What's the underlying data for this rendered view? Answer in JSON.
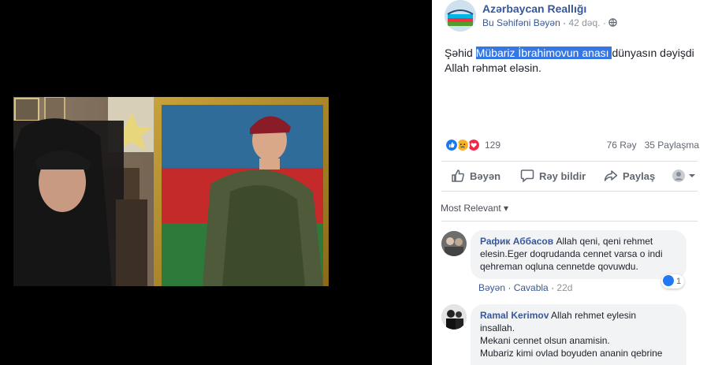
{
  "page": {
    "name": "Azərbaycan Reallığı",
    "like_page": "Bu Səhifəni Bəyən",
    "separator": "·",
    "time": "42 dəq.",
    "privacy_icon": "globe-icon"
  },
  "post": {
    "text_before": "Şəhid ",
    "highlighted": "Mübariz İbrahimovun anası ",
    "text_after": "dünyasın dəyişdi",
    "line2": "Allah rəhmət eləsin."
  },
  "reactions": {
    "count": "129",
    "icons": [
      "like-icon",
      "sad-icon",
      "love-icon"
    ],
    "comments": "76 Rəy",
    "shares": "35 Paylaşma",
    "colors": {
      "like": "#1877f2",
      "sad": "#f7b125",
      "love": "#f0284a"
    }
  },
  "actions": {
    "like": "Bəyən",
    "comment": "Rəy bildir",
    "share": "Paylaş"
  },
  "sort": {
    "label": "Most Relevant",
    "arrow": "▾"
  },
  "comments": [
    {
      "author": "Рафик Аббасов",
      "text_line1": "Allah qeni, qeni rehmet",
      "text_line2": "elesin.Eger doqrudanda cennet varsa o indi",
      "text_line3": "qehreman oqluna cennetde qovuwdu.",
      "like": "Bəyən",
      "reply": "Cavabla",
      "time": "22d",
      "reaction_count": "1"
    },
    {
      "author": "Ramal Kerimov",
      "text_line1": "Allah rehmet eylesin",
      "text_line2": "insallah.",
      "text_line3": "Mekani cennet olsun anamisin.",
      "text_line4": "Mubariz kimi ovlad boyuden ananin qebrine"
    }
  ],
  "colors": {
    "link": "#365899",
    "accent_highlight": "#3578e5"
  }
}
